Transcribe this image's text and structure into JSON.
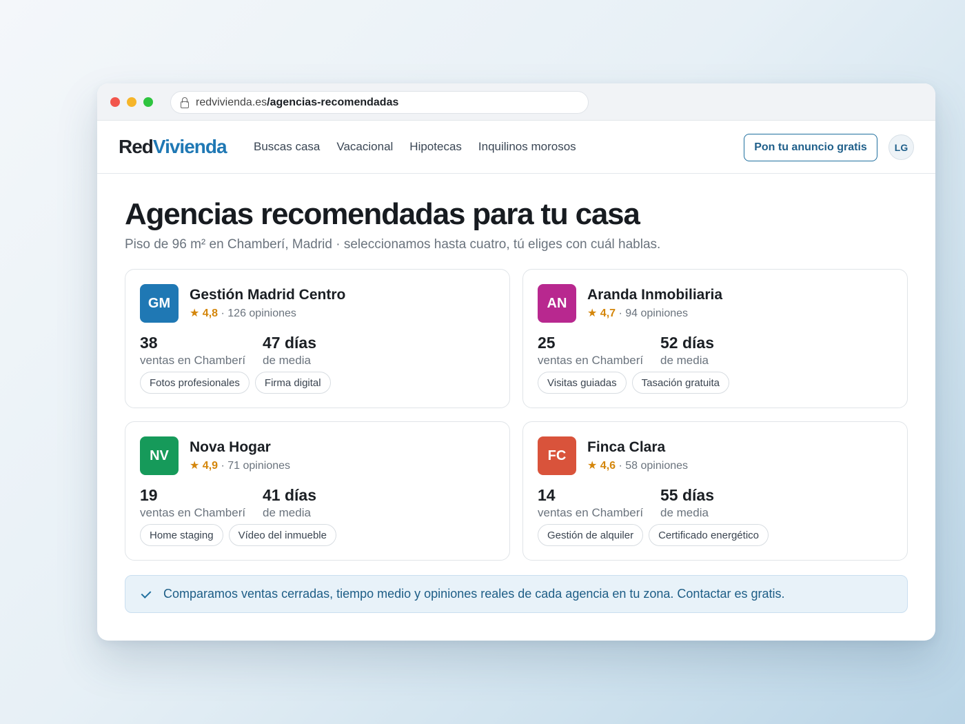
{
  "browser": {
    "url_domain": "redvivienda.es",
    "url_path": "/agencias-recomendadas"
  },
  "nav": {
    "logo_part1": "Red",
    "logo_part2": "Vivienda",
    "links": [
      "Buscas casa",
      "Vacacional",
      "Hipotecas",
      "Inquilinos morosos"
    ],
    "cta_label": "Pon tu anuncio gratis",
    "avatar_initials": "LG"
  },
  "page": {
    "title": "Agencias recomendadas para tu casa",
    "subtitle": "Piso de 96 m² en Chamberí, Madrid · seleccionamos hasta cuatro, tú eliges con cuál hablas."
  },
  "agencies": [
    {
      "initials": "GM",
      "color": "#1f78b4",
      "name": "Gestión Madrid Centro",
      "rating": "4,8",
      "reviews": "126 opiniones",
      "sales": "38",
      "sales_label": "ventas en Chamberí",
      "days": "47 días",
      "days_label": "de media",
      "tags": [
        "Fotos profesionales",
        "Firma digital"
      ]
    },
    {
      "initials": "AN",
      "color": "#b8288f",
      "name": "Aranda Inmobiliaria",
      "rating": "4,7",
      "reviews": "94 opiniones",
      "sales": "25",
      "sales_label": "ventas en Chamberí",
      "days": "52 días",
      "days_label": "de media",
      "tags": [
        "Visitas guiadas",
        "Tasación gratuita"
      ]
    },
    {
      "initials": "NV",
      "color": "#169a5a",
      "name": "Nova Hogar",
      "rating": "4,9",
      "reviews": "71 opiniones",
      "sales": "19",
      "sales_label": "ventas en Chamberí",
      "days": "41 días",
      "days_label": "de media",
      "tags": [
        "Home staging",
        "Vídeo del inmueble"
      ]
    },
    {
      "initials": "FC",
      "color": "#d9533b",
      "name": "Finca Clara",
      "rating": "4,6",
      "reviews": "58 opiniones",
      "sales": "14",
      "sales_label": "ventas en Chamberí",
      "days": "55 días",
      "days_label": "de media",
      "tags": [
        "Gestión de alquiler",
        "Certificado energético"
      ]
    }
  ],
  "note": {
    "text": "Comparamos ventas cerradas, tiempo medio y opiniones reales de cada agencia en tu zona. Contactar es gratis."
  }
}
